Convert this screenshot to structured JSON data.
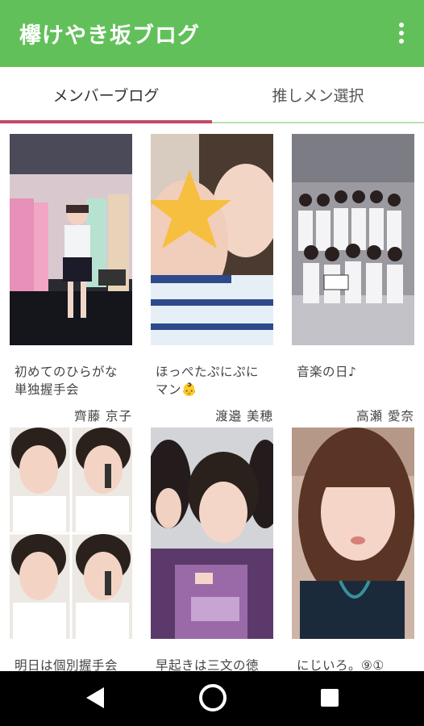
{
  "app": {
    "title": "欅けやき坂ブログ"
  },
  "tabs": [
    {
      "label": "メンバーブログ",
      "selected": true
    },
    {
      "label": "推しメン選択",
      "selected": false
    }
  ],
  "posts": [
    {
      "title_line1": "初めてのひらがな",
      "title_line2": "単独握手会",
      "author": "齊藤 京子"
    },
    {
      "title_line1": "ほっぺたぷにぷに",
      "title_line2": "マン👶",
      "author": "渡邉 美穂"
    },
    {
      "title_line1": "音楽の日♪",
      "title_line2": "",
      "author": "高瀬 愛奈"
    },
    {
      "title_line1": "明日は個別握手会",
      "title_line2": "",
      "author": ""
    },
    {
      "title_line1": "早起きは三文の徳",
      "title_line2": "",
      "author": ""
    },
    {
      "title_line1": "にじいろ。⑨①",
      "title_line2": "",
      "author": ""
    }
  ],
  "colors": {
    "appbar": "#62c05a",
    "tab_indicator": "#c4486a"
  },
  "icons": {
    "overflow": "more-vert-icon",
    "back": "back-icon",
    "home": "home-icon",
    "recents": "recents-icon"
  }
}
